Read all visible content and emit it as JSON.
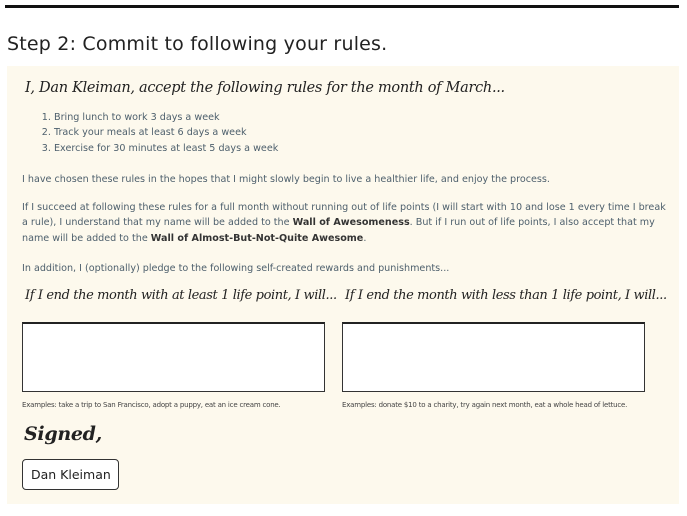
{
  "step": {
    "title": "Step 2: Commit to following your rules."
  },
  "pledge": {
    "heading": "I, Dan Kleiman, accept the following rules for the month of March..."
  },
  "rules": [
    "Bring lunch to work 3 days a week",
    "Track your meals at least 6 days a week",
    "Exercise for 30 minutes at least 5 days a week"
  ],
  "paragraphs": {
    "intro": "I have chosen these rules in the hopes that I might slowly begin to live a healthier life, and enjoy the process.",
    "success_part1": "If I succeed at following these rules for a full month without running out of life points (I will start with 10 and lose 1 every time I break a rule), I understand that my name will be added to the ",
    "wall_awesome": "Wall of Awesomeness",
    "success_part2": ". But if I run out of life points, I also accept that my name will be added to the ",
    "wall_almost": "Wall of Almost-But-Not-Quite Awesome",
    "success_part3": ".",
    "optional": "In addition, I (optionally) pledge to the following self-created rewards and punishments..."
  },
  "reward": {
    "label": "If I end the month with at least 1 life point, I will...",
    "value": "",
    "example": "Examples: take a trip to San Francisco, adopt a puppy, eat an ice cream cone."
  },
  "punishment": {
    "label": "If I end the month with less than 1 life point, I will...",
    "value": "",
    "example": "Examples: donate $10 to a charity, try again next month, eat a whole head of lettuce."
  },
  "signature": {
    "label": "Signed,",
    "value": "Dan Kleiman"
  },
  "colors": {
    "card_background": "#fdf9ed",
    "body_text": "#4d5f6c",
    "heading_text": "#222222"
  }
}
